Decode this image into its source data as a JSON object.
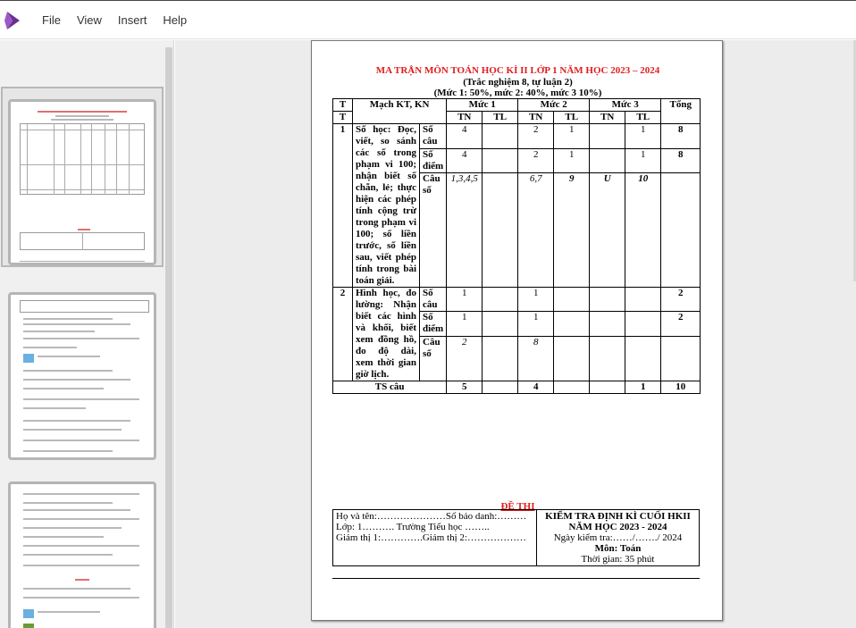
{
  "menu": {
    "file": "File",
    "view": "View",
    "insert": "Insert",
    "help": "Help"
  },
  "doc": {
    "title": "MA TRẬN MÔN TOÁN HỌC KÌ II LỚP 1 NĂM HỌC 2023 – 2024",
    "subtitle1": "(Trắc nghiệm 8, tự luận 2)",
    "subtitle2": "(Mức 1: 50%, mức 2: 40%, mức 3 10%)",
    "matrix": {
      "h_tt": "T T",
      "h_tt1": "T",
      "h_tt2": "T",
      "h_mach": "Mạch KT, KN",
      "h_muc1": "Mức 1",
      "h_muc2": "Mức 2",
      "h_muc3": "Mức 3",
      "h_tong": "Tổng",
      "h_tn": "TN",
      "h_tl": "TL",
      "r1_tt": "1",
      "r1_content": "Số học: Đọc, viết, so sánh các số trong phạm vi 100; nhận biết số chẵn, lẻ; thực hiện các phép tính cộng trừ trong phạm vi 100; số liền trước, số liền sau, viết phép tính trong bài toán giải.",
      "r1_a_label": "Số câu",
      "r1_a": [
        "4",
        "",
        "2",
        "1",
        "",
        "1",
        "8"
      ],
      "r1_b_label": "Số điểm",
      "r1_b": [
        "4",
        "",
        "2",
        "1",
        "",
        "1",
        "8"
      ],
      "r1_c_label": "Câu số",
      "r1_c": [
        "1,3,4,5",
        "",
        "6,7",
        "9",
        "U",
        "10",
        ""
      ],
      "r2_tt": "2",
      "r2_content": "Hình học, đo lường: Nhận biết các hình và khối, biết xem đồng hồ, đo độ dài, xem thời gian giờ lịch.",
      "r2_a_label": "Số câu",
      "r2_a": [
        "1",
        "",
        "1",
        "",
        "",
        "",
        "2"
      ],
      "r2_b_label": "Số điểm",
      "r2_b": [
        "1",
        "",
        "1",
        "",
        "",
        "",
        "2"
      ],
      "r2_c_label": "Câu số",
      "r2_c": [
        "2",
        "",
        "8",
        "",
        "",
        "",
        ""
      ],
      "ts_label": "TS câu",
      "ts": [
        "5",
        "",
        "4",
        "",
        "",
        "1",
        "10"
      ]
    },
    "dethi": "ĐỀ THI",
    "header": {
      "left1": "Họ và tên:…………………Số báo danh:………",
      "left2": "Lớp: 1………. Trường Tiểu học ……..",
      "left3": "Giám thị 1:………….Giám thị 2:………………",
      "right1": "KIỂM TRA ĐỊNH KÌ CUỐI HKII",
      "right2": "NĂM HỌC 2023 - 2024",
      "right3": "Ngày kiểm tra:……/……./ 2024",
      "right4": "Môn: Toán",
      "right5": "Thời gian: 35 phút"
    }
  },
  "colors": {
    "title_red": "#e01d1d",
    "logo": "#7b3fa0",
    "selected_thumb": "#b8b8b8"
  },
  "icons": {
    "logo": "app-logo-icon"
  }
}
